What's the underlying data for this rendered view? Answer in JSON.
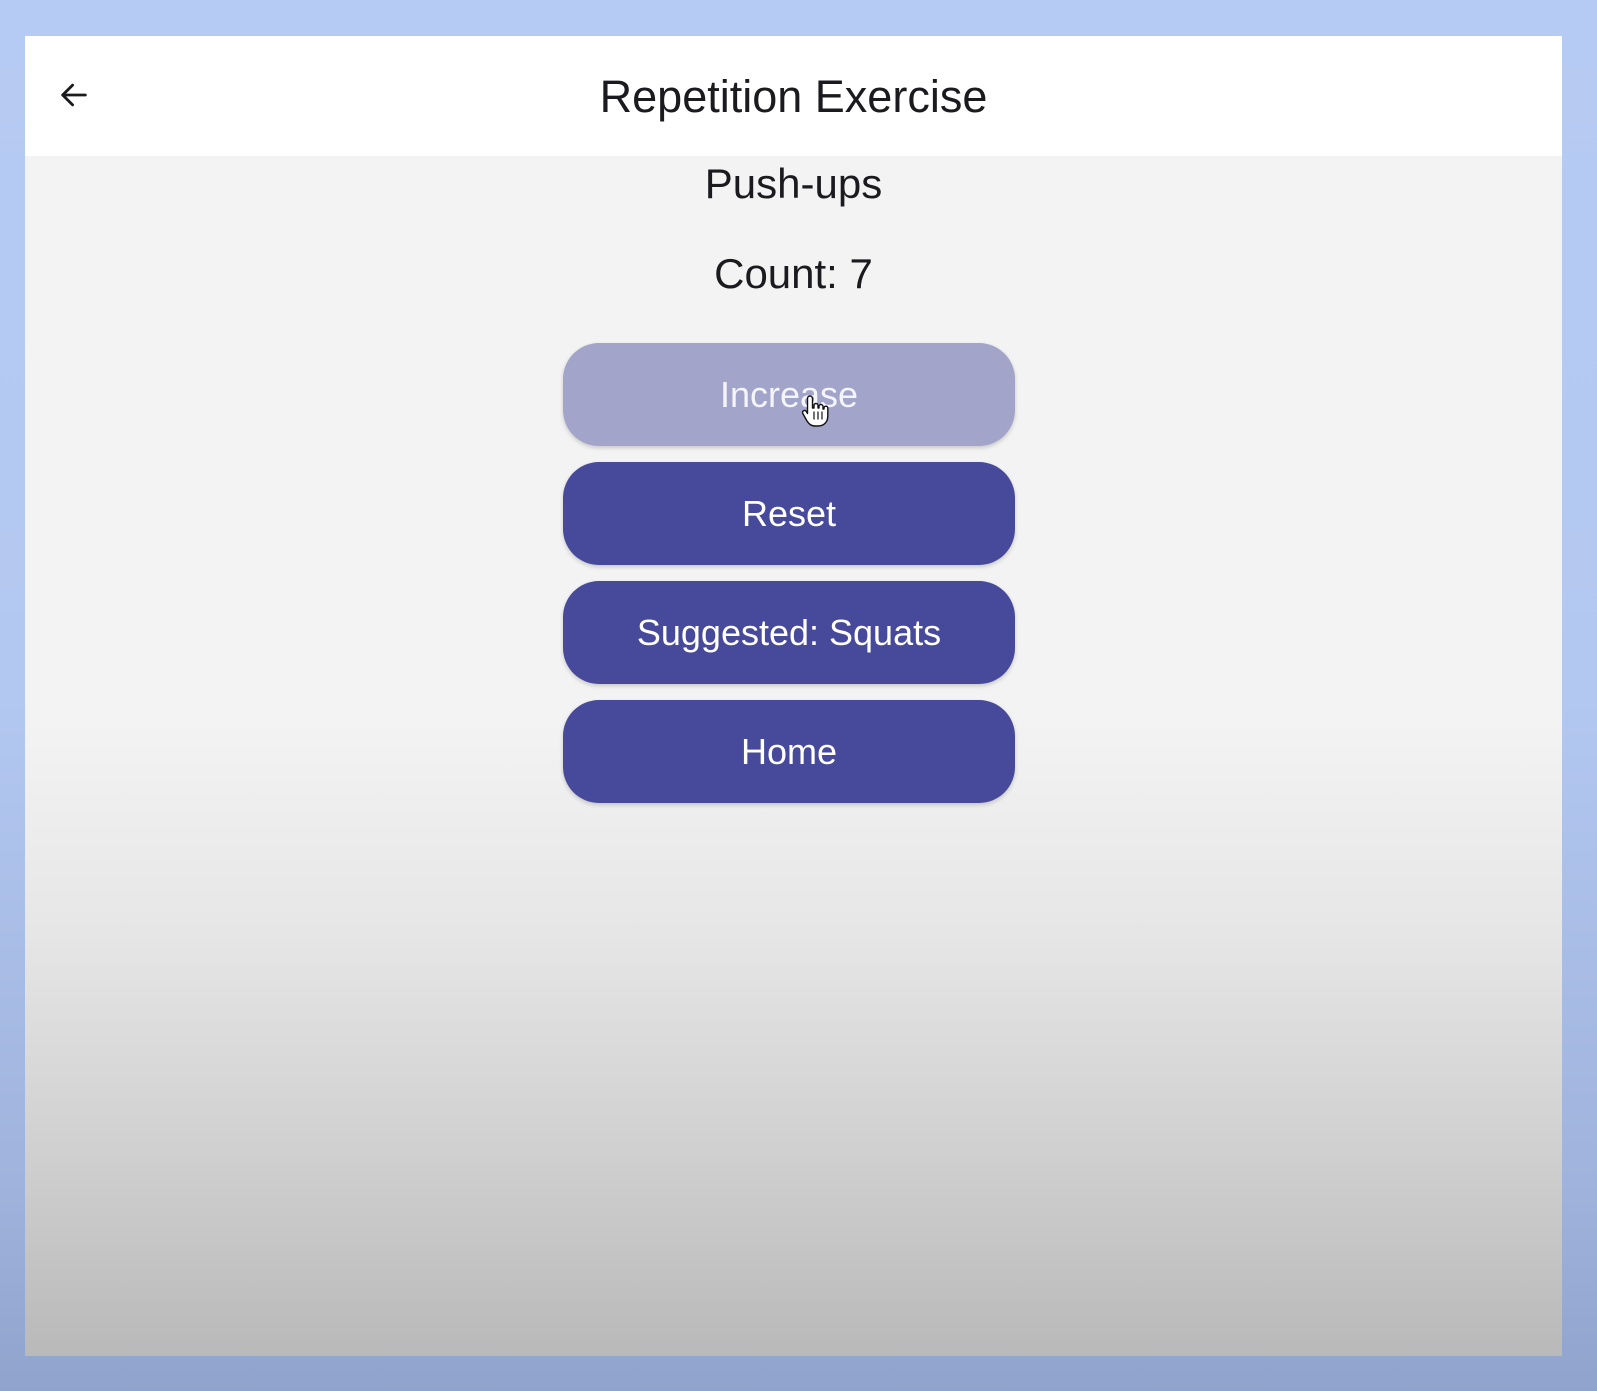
{
  "app_bar": {
    "back_icon": "arrow-left-icon",
    "title": "Repetition Exercise"
  },
  "exercise": {
    "name": "Push-ups",
    "count_text": "Count: 7"
  },
  "buttons": {
    "increase": "Increase",
    "reset": "Reset",
    "suggested": "Suggested: Squats",
    "home": "Home"
  },
  "state": {
    "pressed_button": "increase",
    "cursor_icon": "hand-pointer-icon"
  },
  "colors": {
    "primary": "#474a9a",
    "primary_pressed": "#a3a4c9",
    "app_bar": "#ffffff",
    "surface": "#f3f3f3",
    "outer_frame": "#b6cbf3"
  }
}
